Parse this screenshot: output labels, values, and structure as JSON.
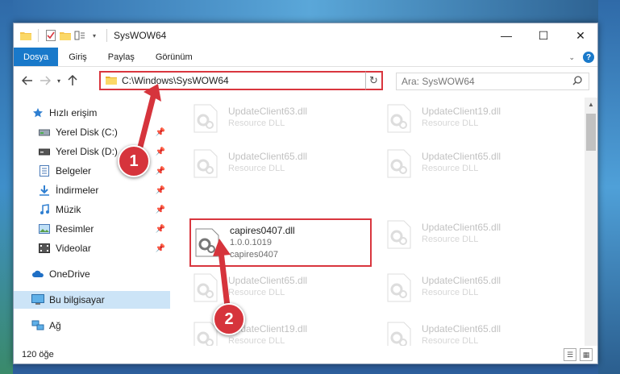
{
  "window": {
    "title": "SysWOW64",
    "controls": {
      "minimize": "—",
      "maximize": "☐",
      "close": "✕"
    }
  },
  "ribbon": {
    "tabs": [
      "Dosya",
      "Giriş",
      "Paylaş",
      "Görünüm"
    ],
    "help_label": "?"
  },
  "nav": {
    "address": "C:\\Windows\\SysWOW64",
    "search_placeholder": "Ara: SysWOW64"
  },
  "sidebar": {
    "items": [
      {
        "label": "Hızlı erişim",
        "icon": "star-icon"
      },
      {
        "label": "Yerel Disk (C:)",
        "icon": "drive-icon",
        "pinned": true
      },
      {
        "label": "Yerel Disk (D:)",
        "icon": "drive-icon",
        "pinned": true
      },
      {
        "label": "Belgeler",
        "icon": "documents-icon",
        "pinned": true
      },
      {
        "label": "İndirmeler",
        "icon": "download-icon",
        "pinned": true
      },
      {
        "label": "Müzik",
        "icon": "music-icon",
        "pinned": true
      },
      {
        "label": "Resimler",
        "icon": "pictures-icon",
        "pinned": true
      },
      {
        "label": "Videolar",
        "icon": "videos-icon",
        "pinned": true
      },
      {
        "label": "OneDrive",
        "icon": "cloud-icon"
      },
      {
        "label": "Bu bilgisayar",
        "icon": "computer-icon",
        "selected": true
      },
      {
        "label": "Ağ",
        "icon": "network-icon"
      }
    ]
  },
  "files": {
    "left": [
      {
        "name": "UpdateClient63.dll",
        "sub": "Resource DLL"
      },
      {
        "name": "UpdateClient65.dll",
        "sub": "Resource DLL"
      },
      {
        "name": "capires0407.dll",
        "version": "1.0.0.1019",
        "sub": "capires0407"
      },
      {
        "name": "UpdateClient65.dll",
        "sub": "Resource DLL"
      },
      {
        "name": "UpdateClient19.dll",
        "sub": "Resource DLL"
      }
    ],
    "right": [
      {
        "name": "UpdateClient19.dll",
        "sub": "Resource DLL"
      },
      {
        "name": "UpdateClient65.dll",
        "sub": "Resource DLL"
      },
      {
        "name": "UpdateClient65.dll",
        "sub": "Resource DLL"
      },
      {
        "name": "UpdateClient65.dll",
        "sub": "Resource DLL"
      },
      {
        "name": "UpdateClient65.dll",
        "sub": "Resource DLL"
      }
    ]
  },
  "status": {
    "count": "120 öğe"
  },
  "callouts": [
    "1",
    "2"
  ],
  "colors": {
    "accent": "#1979ca",
    "highlight": "#d9363e",
    "selected": "#cce4f7"
  }
}
